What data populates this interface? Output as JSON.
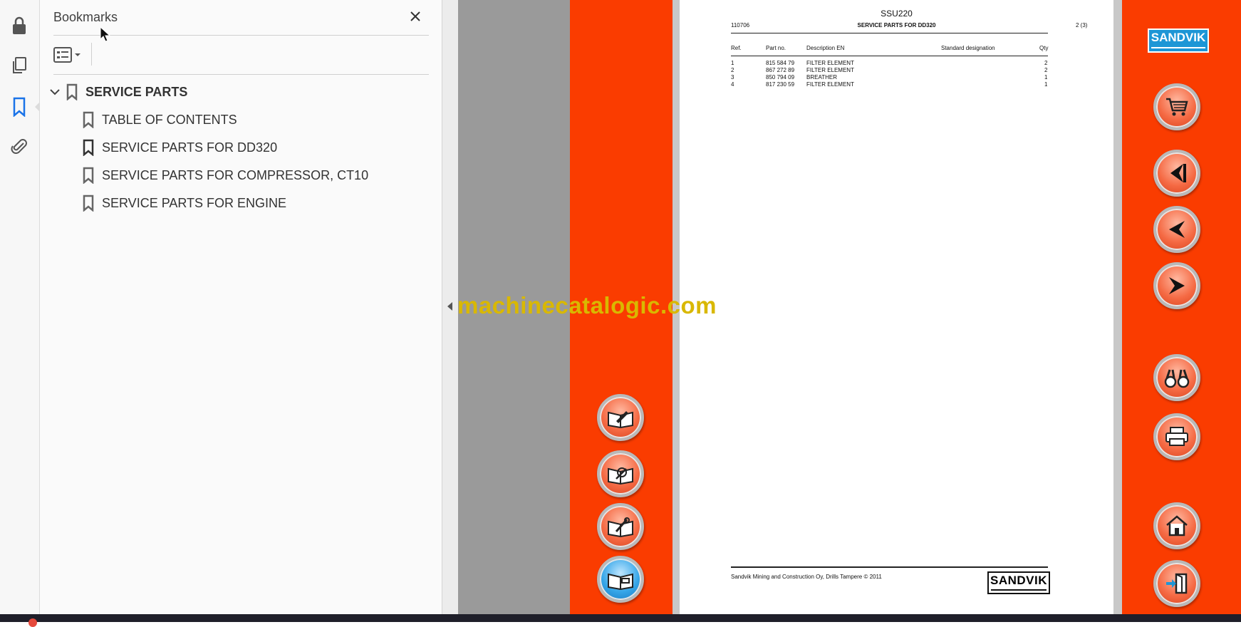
{
  "sidebar": {
    "title": "Bookmarks",
    "tools": [
      "lock-icon",
      "pages-icon",
      "bookmark-icon",
      "attachment-icon"
    ]
  },
  "bookmarks": {
    "root": "SERVICE PARTS",
    "items": [
      {
        "label": "TABLE OF CONTENTS"
      },
      {
        "label": "SERVICE PARTS FOR DD320"
      },
      {
        "label": "SERVICE PARTS FOR COMPRESSOR, CT10"
      },
      {
        "label": "SERVICE PARTS FOR ENGINE"
      }
    ]
  },
  "document": {
    "title": "SSU220",
    "doc_no": "110706",
    "heading": "SERVICE PARTS FOR DD320",
    "page": "2 (3)",
    "columns": [
      "Ref.",
      "Part no.",
      "Description EN",
      "Standard designation",
      "Qty"
    ],
    "rows": [
      {
        "ref": "1",
        "part": "815 584 79",
        "desc": "FILTER ELEMENT",
        "qty": "2"
      },
      {
        "ref": "2",
        "part": "867 272 89",
        "desc": "FILTER ELEMENT",
        "qty": "2"
      },
      {
        "ref": "3",
        "part": "850 794 09",
        "desc": "BREATHER",
        "qty": "1"
      },
      {
        "ref": "4",
        "part": "817 230 59",
        "desc": "FILTER ELEMENT",
        "qty": "1"
      }
    ],
    "footer": "Sandvik Mining and Construction Oy, Drills Tampere © 2011",
    "logo_text": "SANDVIK"
  },
  "brand": {
    "logo_text": "SANDVIK",
    "accent": "#fa3c00",
    "blue": "#1d96d6"
  },
  "watermark": "machinecatalogic.com",
  "left_nav_buttons": [
    "edit-parts-icon",
    "service-book-icon",
    "tools-book-icon",
    "info-book-icon"
  ],
  "right_nav_buttons": [
    "cart-icon",
    "first-page-icon",
    "previous-icon",
    "next-icon",
    "search-binoculars-icon",
    "printer-icon",
    "home-icon",
    "exit-icon"
  ]
}
